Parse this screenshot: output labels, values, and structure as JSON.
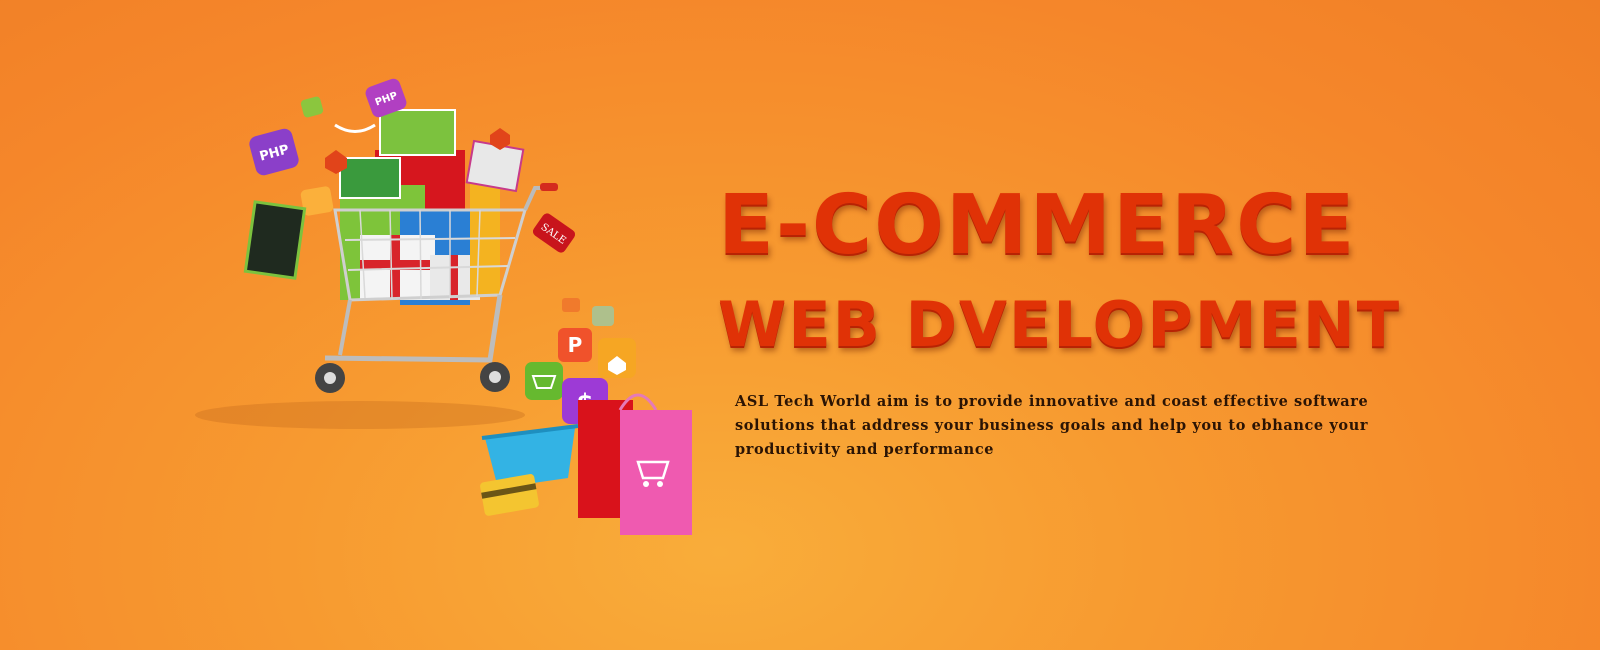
{
  "hero": {
    "headline_line1": "E-COMMERCE",
    "headline_line2": "WEB DVELOPMENT",
    "description": "ASL Tech World aim is to provide innovative and coast effective software solutions that address your business goals and help you to ebhance your productivity and performance"
  },
  "illustration": {
    "php_badge": "PHP",
    "sale_tag": "SALE",
    "dollar_icon": "$"
  },
  "colors": {
    "background": "#f5892b",
    "headline": "#e03206",
    "description": "#2b1404"
  },
  "icons": [
    "shopping-cart-icon",
    "php-badge-icon",
    "magento-icon",
    "amazon-icon",
    "paypal-icon",
    "dollar-icon",
    "cart-app-icon",
    "shopping-bag-icon",
    "basket-icon",
    "credit-card-icon",
    "sale-tag-icon"
  ]
}
